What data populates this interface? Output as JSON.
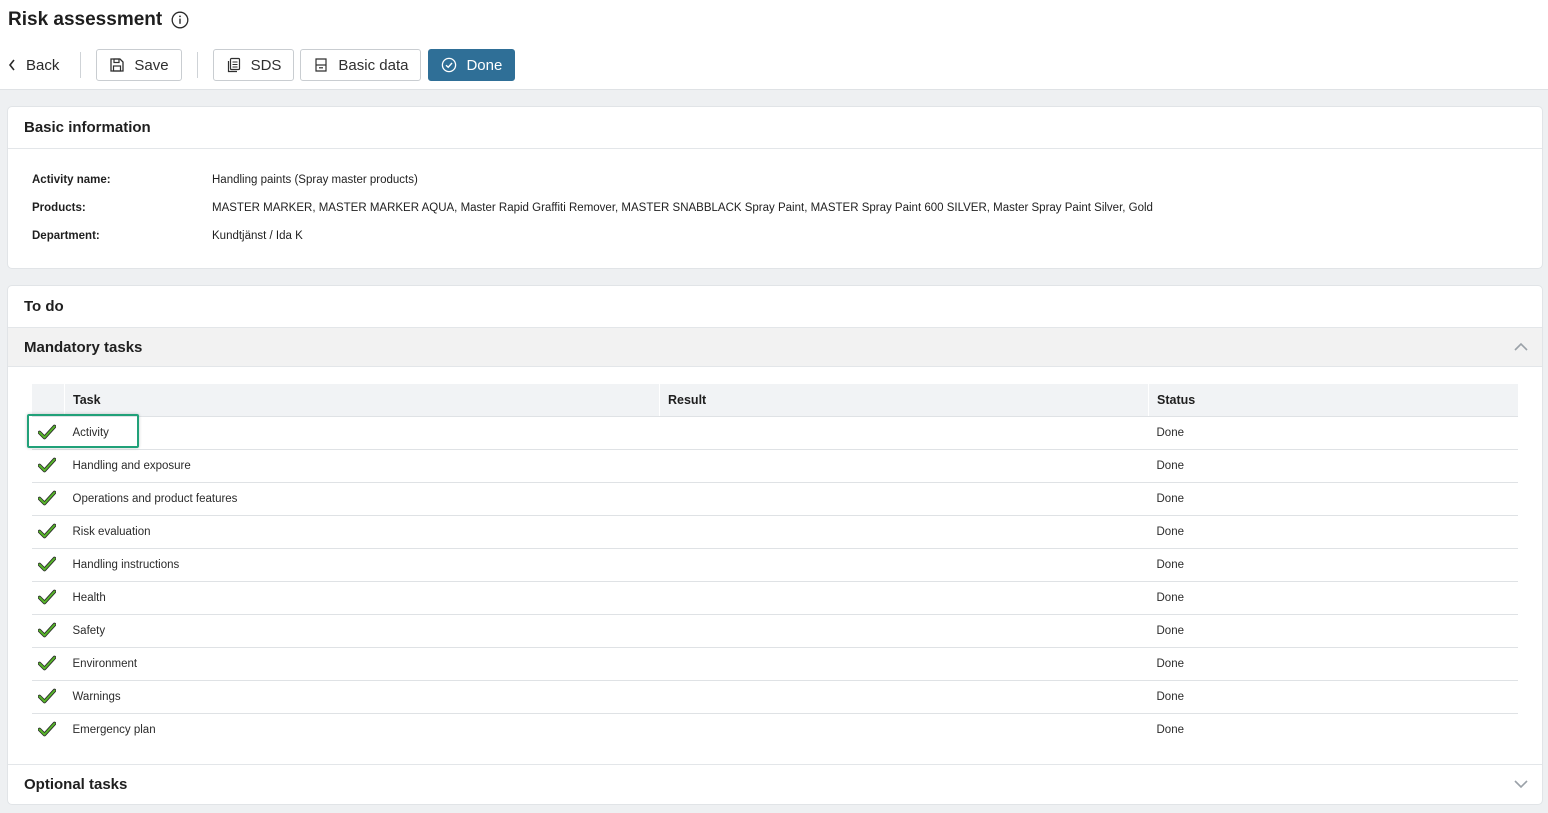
{
  "header": {
    "title": "Risk assessment",
    "info_icon": "info-circle-icon"
  },
  "toolbar": {
    "back_label": "Back",
    "save_label": "Save",
    "sds_label": "SDS",
    "basic_data_label": "Basic data",
    "done_label": "Done"
  },
  "basic_info": {
    "title": "Basic information",
    "fields": [
      {
        "label": "Activity name:",
        "value": "Handling paints (Spray master products)"
      },
      {
        "label": "Products:",
        "value": "MASTER MARKER, MASTER MARKER AQUA, Master Rapid Graffiti Remover, MASTER SNABBLACK Spray Paint, MASTER Spray Paint 600 SILVER, Master Spray Paint Silver, Gold"
      },
      {
        "label": "Department:",
        "value": "Kundtjänst / Ida K"
      }
    ]
  },
  "todo": {
    "title": "To do",
    "mandatory_title": "Mandatory tasks",
    "optional_title": "Optional tasks",
    "columns": [
      "Task",
      "Result",
      "Status"
    ],
    "tasks": [
      {
        "task": "Activity",
        "result": "",
        "status": "Done"
      },
      {
        "task": "Handling and exposure",
        "result": "",
        "status": "Done"
      },
      {
        "task": "Operations and product features",
        "result": "",
        "status": "Done"
      },
      {
        "task": "Risk evaluation",
        "result": "",
        "status": "Done"
      },
      {
        "task": "Handling instructions",
        "result": "",
        "status": "Done"
      },
      {
        "task": "Health",
        "result": "",
        "status": "Done"
      },
      {
        "task": "Safety",
        "result": "",
        "status": "Done"
      },
      {
        "task": "Environment",
        "result": "",
        "status": "Done"
      },
      {
        "task": "Warnings",
        "result": "",
        "status": "Done"
      },
      {
        "task": "Emergency plan",
        "result": "",
        "status": "Done"
      }
    ]
  },
  "colors": {
    "primary": "#2f6f97",
    "check_green": "#57b52a",
    "highlight": "#21a179"
  }
}
